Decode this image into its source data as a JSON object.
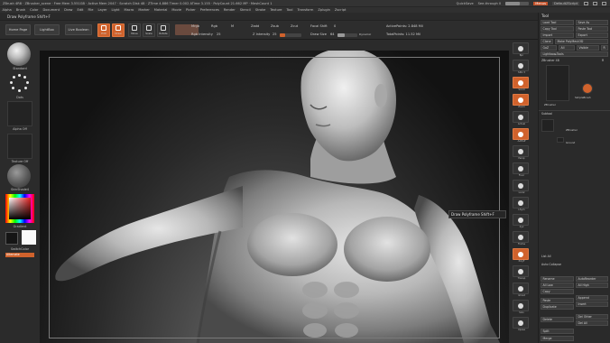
{
  "titlebar": {
    "text": "ZBrush 4R8 · ZBrusher_scene · Free Mem 3.551GB · Active Mem 2047 · Scratch Disk 48 · ZTime 4.886 Timer 0.002 ATime 3.155 · PolyCount 21.662 MP · MeshCount 1",
    "quicksave": "QuickSave",
    "seethrough": "See-through 0",
    "menus": "Menus",
    "default_zscript": "DefaultZScript"
  },
  "menubar": [
    "Alpha",
    "Brush",
    "Color",
    "Document",
    "Draw",
    "Edit",
    "File",
    "Layer",
    "Light",
    "Macro",
    "Marker",
    "Material",
    "Movie",
    "Picker",
    "Preferences",
    "Render",
    "Stencil",
    "Stroke",
    "Texture",
    "Tool",
    "Transform",
    "Zplugin",
    "Zscript"
  ],
  "subtitle": "Draw Polyframe  Shift+F",
  "toolbar": {
    "home_page": "Home Page",
    "lightbox": "LightBox",
    "live_boolean": "Live Boolean",
    "tools": [
      {
        "label": "Edit",
        "active": true
      },
      {
        "label": "Draw",
        "active": true
      },
      {
        "label": "Move",
        "active": false
      },
      {
        "label": "Scale",
        "active": false
      },
      {
        "label": "Rotate",
        "active": false
      }
    ],
    "mrgb": "Mrgb",
    "rgb": "Rgb",
    "m": "M",
    "zadd": "Zadd",
    "zsub": "Zsub",
    "zcut": "Zcut",
    "rgb_intensity": "Rgb Intensity",
    "rgb_intensity_value": "25",
    "z_intensity": "Z Intensity",
    "z_intensity_value": "25",
    "focal_shift": "Focal Shift",
    "focal_shift_value": "0",
    "draw_size": "Draw Size",
    "draw_size_value": "64",
    "dynamic": "Dynamic",
    "active_points": "ActivePoints: 2.848 Mil",
    "total_points": "TotalPoints: 11.52 Mil"
  },
  "leftshelf": {
    "brush": "Standard",
    "stroke": "Dots",
    "alpha": "Alpha Off",
    "texture": "Texture Off",
    "material": "SkinShade4",
    "gradient": "Gradient",
    "switch_color": "SwitchColor",
    "alternate": "Alternate"
  },
  "tooltip": "Draw Polyframe  Shift+F",
  "rshelf": [
    "Bpr",
    "SPix 3",
    "Scroll",
    "Zoom",
    "Actual",
    "AAHalf",
    "Persp",
    "Floor",
    "Local",
    "LSym",
    "Xyz",
    "Frame",
    "Move",
    "Scale",
    "Rotate",
    "Line Fill",
    "PolyF",
    "Transp",
    "Ghost",
    "Solo",
    "Xpose"
  ],
  "rpanel": {
    "title": "Tool",
    "load_tool": "Load Tool",
    "save_as": "Save As",
    "copy_tool": "Copy Tool",
    "paste_tool": "Paste Tool",
    "import": "Import",
    "export": "Export",
    "clone": "Clone",
    "make_polymesh": "Make PolyMesh3D",
    "goz": "GoZ",
    "all": "All",
    "visible": "Visible",
    "r": "R",
    "lightbox_tools": "Lightbox▸Tools",
    "zbrusher": "ZBrusher 48",
    "r2": "R",
    "tool_names": [
      "ZBrusher",
      "SimpleBrush"
    ],
    "subtool": "Subtool",
    "subtool_items": [
      "ZBrusher",
      "Ground"
    ],
    "list_all": "List All",
    "auto_collapse": "Auto Collapse",
    "rename": "Rename",
    "autoreorder": "AutoReorder",
    "all_low": "All Low",
    "all_high": "All High",
    "copy": "Copy",
    "paste": "Paste",
    "duplicate": "Duplicate",
    "append": "Append",
    "insert": "Insert",
    "del_other": "Del Other",
    "delete": "Delete",
    "del_all": "Del All",
    "split": "Split",
    "merge": "Merge"
  },
  "colors": {
    "accent": "#d0622c",
    "panel_bg": "#2b2b2b",
    "viewport_bg": "#1a1a1a"
  }
}
